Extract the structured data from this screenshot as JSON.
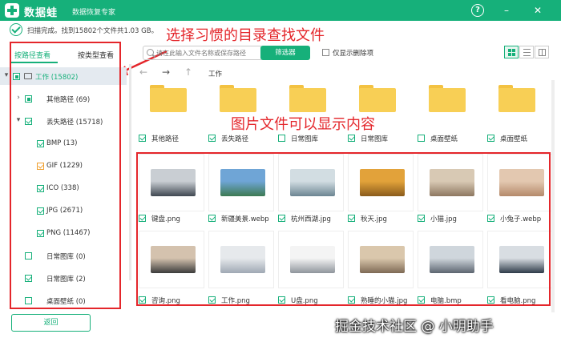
{
  "app": {
    "name": "数据蛙",
    "subtitle": "数据恢复专家"
  },
  "window_controls": {
    "help": "?",
    "minimize": "–",
    "close": "✕"
  },
  "status": {
    "text": "扫描完成。找到15802个文件共1.03 GB。"
  },
  "annotations": {
    "directory_hint": "选择习惯的目录查找文件",
    "image_hint": "图片文件可以显示内容"
  },
  "sidebar": {
    "tabs": [
      {
        "label": "按路径查看",
        "active": true
      },
      {
        "label": "按类型查看",
        "active": false
      }
    ],
    "tree": [
      {
        "label": "工作 (15802)",
        "state": "partial",
        "expander": "▾",
        "kind": "drive"
      },
      {
        "label": "其他路径 (69)",
        "state": "partial",
        "expander": "›"
      },
      {
        "label": "丢失路径 (15718)",
        "state": "checked",
        "expander": "▾"
      },
      {
        "label": "BMP (13)",
        "state": "checked"
      },
      {
        "label": "GIF (1229)",
        "state": "checked-orange"
      },
      {
        "label": "ICO (338)",
        "state": "checked"
      },
      {
        "label": "JPG (2671)",
        "state": "checked"
      },
      {
        "label": "PNG (11467)",
        "state": "checked"
      },
      {
        "label": "日常图库 (0)",
        "state": "unchecked"
      },
      {
        "label": "日常图库 (2)",
        "state": "checked"
      },
      {
        "label": "桌面壁纸 (0)",
        "state": "unchecked"
      }
    ],
    "back_button": "返回"
  },
  "toolbar": {
    "search_placeholder": "请在此输入文件名称或保存路径",
    "filter_button": "筛选器",
    "only_deleted": "仅显示删除项"
  },
  "nav": {
    "back": "←",
    "forward": "→",
    "up": "↑",
    "path": "工作"
  },
  "folders": [
    {
      "name": "其他路径",
      "checked": true
    },
    {
      "name": "丢失路径",
      "checked": true
    },
    {
      "name": "日常图库",
      "checked": false
    },
    {
      "name": "日常图库",
      "checked": true
    },
    {
      "name": "桌面壁纸",
      "checked": false
    },
    {
      "name": "桌面壁纸",
      "checked": true
    }
  ],
  "images": [
    {
      "name": "键盘.png",
      "icon": "keyboard-thumbnail",
      "colors": [
        "#c9ced3",
        "#3f4750"
      ]
    },
    {
      "name": "新疆美景.webp",
      "icon": "landscape-thumbnail",
      "colors": [
        "#6fa5d6",
        "#3d7a52"
      ]
    },
    {
      "name": "杭州西湖.jpg",
      "icon": "lake-thumbnail",
      "colors": [
        "#d2dde2",
        "#6c8592"
      ]
    },
    {
      "name": "秋天.jpg",
      "icon": "autumn-thumbnail",
      "colors": [
        "#e2a23a",
        "#8a5b1c"
      ]
    },
    {
      "name": "小猫.jpg",
      "icon": "kitten-thumbnail",
      "colors": [
        "#d8c9b4",
        "#8d7760"
      ]
    },
    {
      "name": "小兔子.webp",
      "icon": "bunny-thumbnail",
      "colors": [
        "#e3c8b0",
        "#b4896a"
      ]
    },
    {
      "name": "咨询.png",
      "icon": "consulting-thumbnail",
      "colors": [
        "#d4c2ae",
        "#3b3b3b"
      ]
    },
    {
      "name": "工作.png",
      "icon": "work-thumbnail",
      "colors": [
        "#e6e9ec",
        "#9fa8b3"
      ]
    },
    {
      "name": "U盘.png",
      "icon": "usb-thumbnail",
      "colors": [
        "#f4f4f4",
        "#8f959c"
      ]
    },
    {
      "name": "熟睡的小猫.jpg",
      "icon": "sleeping-cat-thumbnail",
      "colors": [
        "#dac7ac",
        "#7e6a55"
      ]
    },
    {
      "name": "电脑.bmp",
      "icon": "computer-thumbnail",
      "colors": [
        "#cfd6dc",
        "#5c6570"
      ]
    },
    {
      "name": "看电脑.png",
      "icon": "watching-computer-thumbnail",
      "colors": [
        "#d8dde2",
        "#2e3b49"
      ]
    }
  ],
  "watermark": "掘金技术社区 @ 小明助手"
}
